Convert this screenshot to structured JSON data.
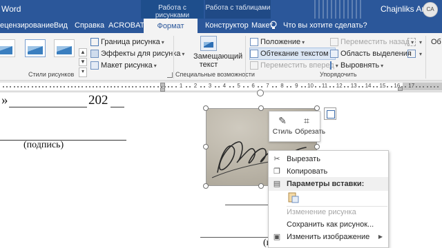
{
  "titlebar": {
    "app_title": "Word",
    "context_group_picture": "Работа с рисунками",
    "context_group_table": "Работа с таблицами",
    "user_name": "Chajnliks Anti",
    "user_initials": "CA"
  },
  "tabs": [
    {
      "label": "ецензирование"
    },
    {
      "label": "Вид"
    },
    {
      "label": "Справка"
    },
    {
      "label": "ACROBAT"
    },
    {
      "label": "Формат",
      "active": true
    },
    {
      "label": "Конструктор"
    },
    {
      "label": "Макет"
    }
  ],
  "search": {
    "text": "Что вы хотите сделать?",
    "icon": "lightbulb-icon"
  },
  "ribbon": {
    "picture_styles": {
      "border": "Граница рисунка",
      "effects": "Эффекты для рисунка",
      "layout": "Макет рисунка",
      "group_label": "Стили рисунков"
    },
    "accessibility": {
      "alt_text_line1": "Замещающий",
      "alt_text_line2": "текст",
      "group_label": "Специальные возможности"
    },
    "arrange": {
      "position": "Положение",
      "wrap_text": "Обтекание текстом",
      "bring_forward": "Переместить вперед",
      "send_backward": "Переместить назад",
      "selection_pane": "Область выделения",
      "align": "Выровнять",
      "group_label": "Упорядочить"
    },
    "size_fragment": "Об"
  },
  "ruler": {
    "numbers": [
      "1",
      "2",
      "3",
      "4",
      "5",
      "6",
      "7",
      "8",
      "9",
      "10",
      "11",
      "12",
      "13",
      "14",
      "15",
      "16",
      "17"
    ]
  },
  "document": {
    "quote_mark": "»",
    "year": "202",
    "signature_caption": "(подпись)",
    "bottom_fragment": "(п"
  },
  "mini_toolbar": {
    "style_label": "Стиль",
    "crop_label": "Обрезать"
  },
  "context_menu": {
    "cut": "Вырезать",
    "copy": "Копировать",
    "paste_options": "Параметры вставки:",
    "change_picture": "Изменение рисунка",
    "save_as_picture": "Сохранить как рисунок...",
    "edit_image": "Изменить изображение"
  },
  "colors": {
    "word_blue": "#2b579a",
    "ribbon_bg": "#f3f3f3"
  }
}
